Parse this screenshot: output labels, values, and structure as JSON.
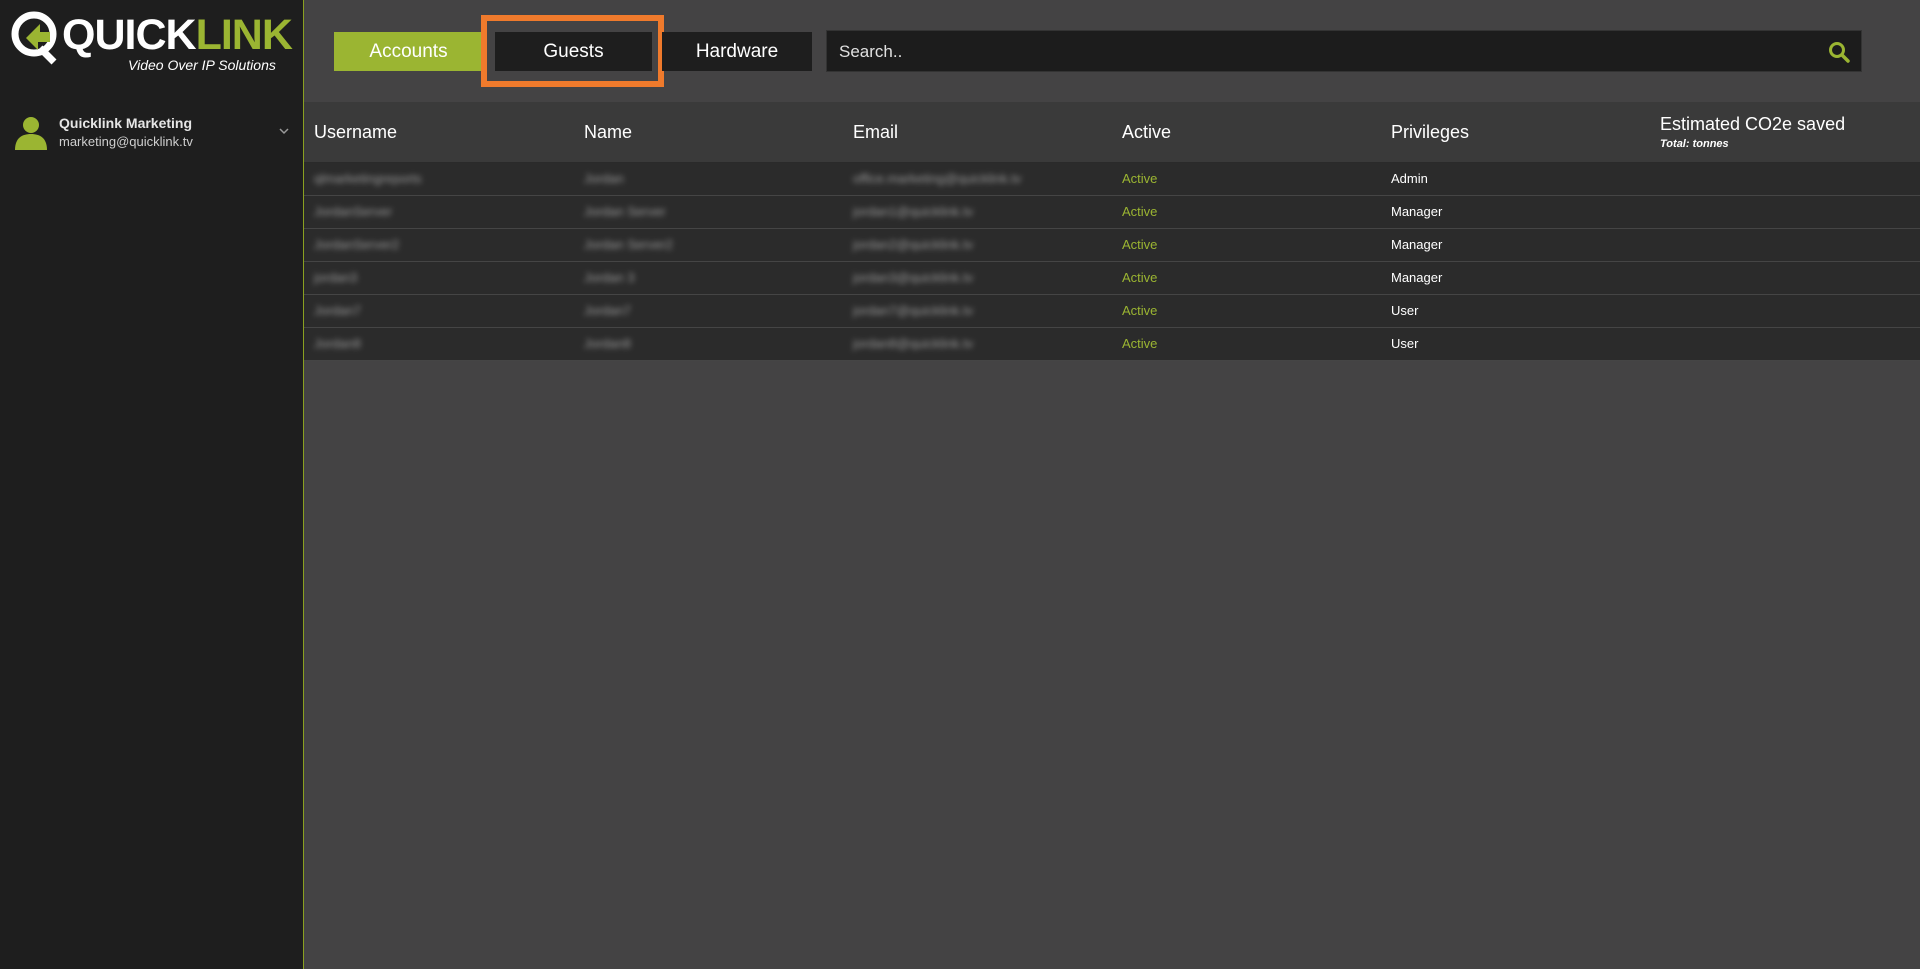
{
  "brand": {
    "name_part1": "QUICK",
    "name_part2": "LINK",
    "tagline": "Video Over IP Solutions",
    "accent_color": "#9bb532",
    "highlight_color": "#ef7a2c"
  },
  "user": {
    "name": "Quicklink Marketing",
    "email": "marketing@quicklink.tv"
  },
  "tabs": [
    {
      "label": "Accounts",
      "selected": true
    },
    {
      "label": "Guests",
      "selected": false
    },
    {
      "label": "Hardware",
      "selected": false
    }
  ],
  "search": {
    "placeholder": "Search.."
  },
  "table": {
    "columns": {
      "username": "Username",
      "name": "Name",
      "email": "Email",
      "active": "Active",
      "privileges": "Privileges",
      "co2": "Estimated CO2e saved",
      "co2_total": "Total: tonnes"
    },
    "rows": [
      {
        "username": "qlmarketingreports",
        "name": "Jordan",
        "email": "office.marketing@quicklink.tv",
        "active": "Active",
        "privileges": "Admin"
      },
      {
        "username": "JordanServer",
        "name": "Jordan Server",
        "email": "jordan1@quicklink.tv",
        "active": "Active",
        "privileges": "Manager"
      },
      {
        "username": "JordanServer2",
        "name": "Jordan Server2",
        "email": "jordan2@quicklink.tv",
        "active": "Active",
        "privileges": "Manager"
      },
      {
        "username": "jordan3",
        "name": "Jordan 3",
        "email": "jordan3@quicklink.tv",
        "active": "Active",
        "privileges": "Manager"
      },
      {
        "username": "Jordan7",
        "name": "Jordan7",
        "email": "jordan7@quicklink.tv",
        "active": "Active",
        "privileges": "User"
      },
      {
        "username": "Jordan8",
        "name": "Jordan8",
        "email": "jordan8@quicklink.tv",
        "active": "Active",
        "privileges": "User"
      }
    ]
  }
}
